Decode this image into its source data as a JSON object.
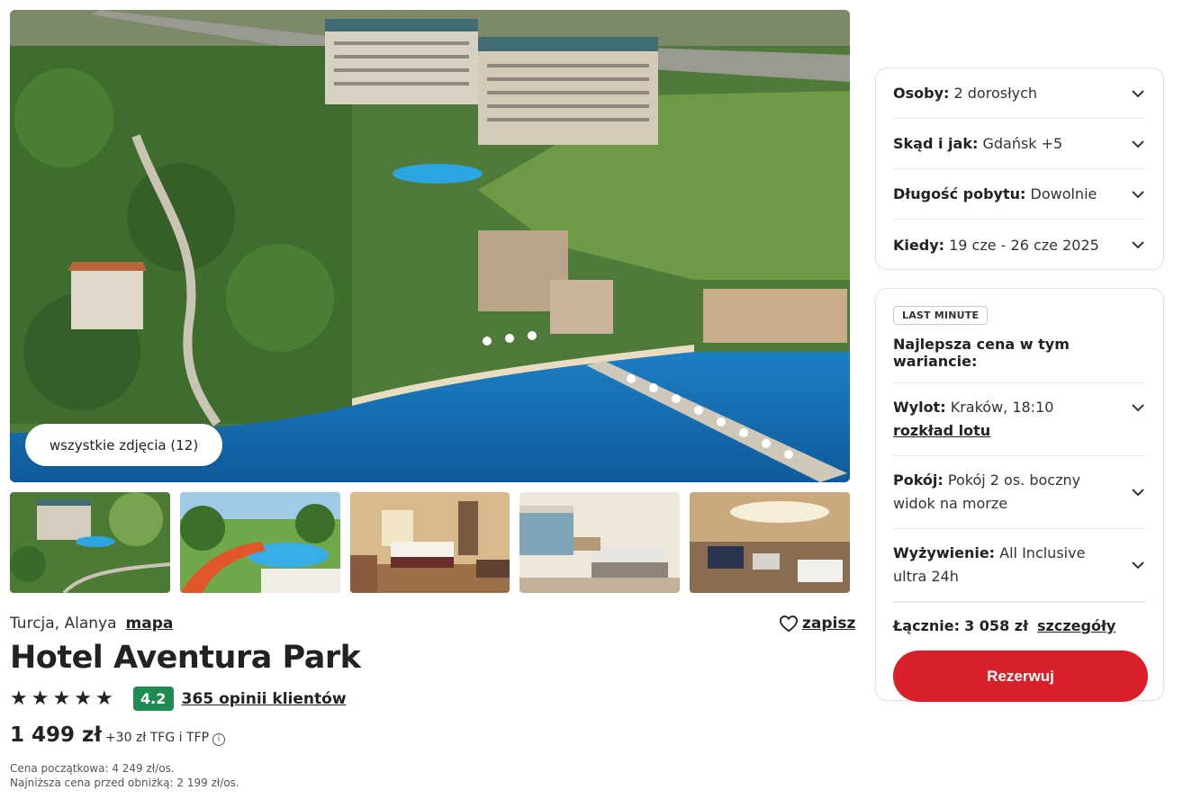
{
  "gallery": {
    "all_photos_label": "wszystkie zdjęcia (12)",
    "thumbnails": [
      "hotel-aerial-thumb",
      "water-slide-thumb",
      "room-thumb",
      "sea-view-room-thumb",
      "lobby-thumb"
    ]
  },
  "hotel": {
    "country_city": "Turcja, Alanya",
    "map_link": "mapa",
    "save_label": "zapisz",
    "name": "Hotel Aventura Park",
    "stars": 5,
    "rating": "4.2",
    "reviews_label": "365 opinii klientów",
    "price": "1 499 zł",
    "price_extra": "+30 zł TFG i TFP",
    "initial_price": "Cena początkowa: 4 249 zł/os.",
    "lowest_price": "Najniższa cena przed obniżką: 2 199 zł/os."
  },
  "search": {
    "persons_label": "Osoby:",
    "persons_value": "2 dorosłych",
    "from_label": "Skąd i jak:",
    "from_value": "Gdańsk +5",
    "duration_label": "Długość pobytu:",
    "duration_value": "Dowolnie",
    "when_label": "Kiedy:",
    "when_value": "19 cze - 26 cze 2025"
  },
  "offer": {
    "badge": "LAST MINUTE",
    "best_price": "Najlepsza cena w tym wariancie:",
    "departure_label": "Wylot:",
    "departure_value": "Kraków, 18:10",
    "schedule_link": "rozkład lotu",
    "room_label": "Pokój:",
    "room_value": "Pokój 2 os. boczny widok na morze",
    "board_label": "Wyżywienie:",
    "board_value": "All Inclusive ultra 24h",
    "total_label": "Łącznie:",
    "total_value": "3 058 zł",
    "details_link": "szczegóły",
    "book_button": "Rezerwuj"
  },
  "colors": {
    "brand_red": "#d9202a",
    "rating_green": "#1f8a52"
  }
}
